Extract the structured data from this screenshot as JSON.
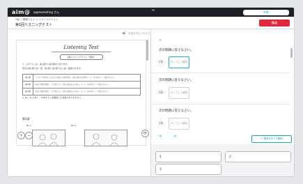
{
  "header": {
    "logo": "aim@",
    "user": "appmarketing さん",
    "caret": "^",
    "top_button": "中断",
    "breadcrumb": "3級 > 模擬テスト > リスニングテスト",
    "title": "第1回リスニングテスト",
    "submit_button": "採点"
  },
  "left": {
    "volume_label": "音源を再生できます",
    "paper": {
      "title": "Listening Test",
      "box_label": "3級リスニングテスト（問題）",
      "intro1": "1. このテストは，第1部から第3部まであります。",
      "intro2": "   英文は第1部では一度，第2部と第3部では二度，放送されます。",
      "rows": [
        {
          "label": "第1部",
          "text": "イラストを参考にしながら対話と応答を聞き，最も適切な応答を1，2，3の中から一つ選びなさい。"
        },
        {
          "label": "第2部",
          "text": "対話と質問を聞き，その答えとして最も適切なものを1，2，3，4の中から一つ選びなさい。"
        },
        {
          "label": "第3部",
          "text": "英文と質問を聞き，その答えとして最も適切なものを1，2，3，4の中から一つ選びなさい。"
        }
      ],
      "note": "2. No. 30 のあと，10秒すると試験終了の合図がありますので，",
      "section": "第1部",
      "no1": "No.1",
      "no2": "No.2"
    },
    "zoom_in": "+",
    "zoom_out": "−",
    "rotate": "⟳"
  },
  "right": {
    "nav_arrow": ">",
    "questions": [
      {
        "prompt": "次の問題に答えなさい。",
        "number": "(1)",
        "tap": "タップして解答"
      },
      {
        "prompt": "次の問題に答えなさい。",
        "number": "(2)",
        "tap": "タップして解答"
      },
      {
        "prompt": "次の問題に答えなさい。",
        "number": "(3)",
        "tap": "タップして解答"
      }
    ],
    "prev": "<",
    "next": ">",
    "clear_button": "✕ 選択をすべて解除"
  },
  "answers": {
    "options": [
      "1",
      "2",
      "3"
    ]
  },
  "colors": {
    "accent": "#14a7b5",
    "submit": "#e3263c",
    "topbar": "#1c1f24"
  }
}
